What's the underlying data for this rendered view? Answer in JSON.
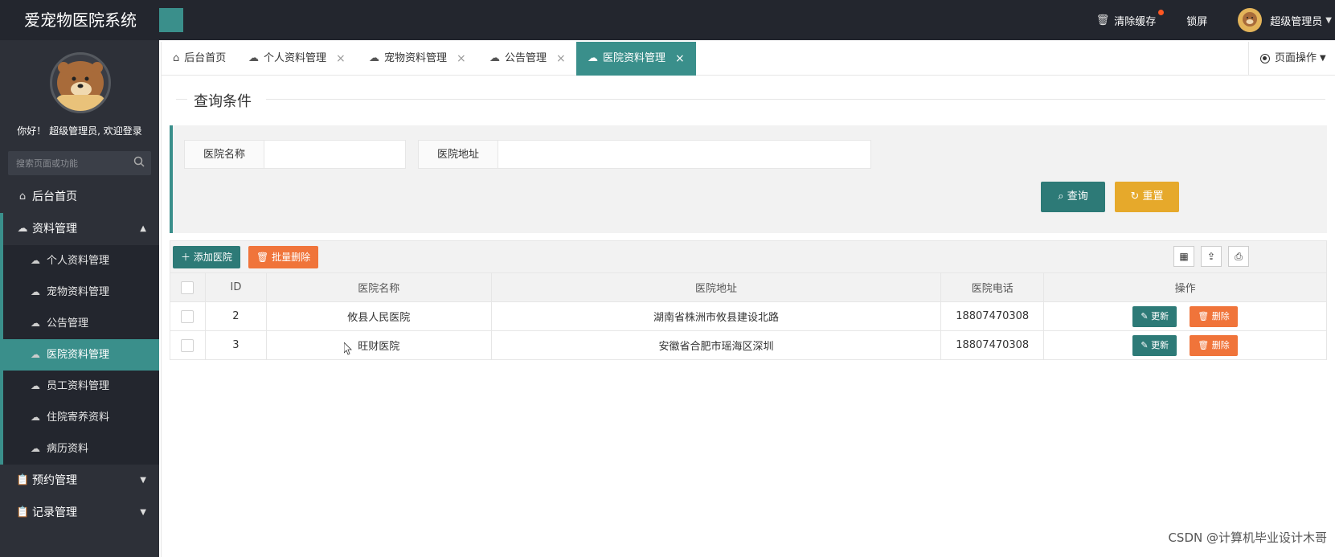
{
  "topbar": {
    "brand": "爱宠物医院系统",
    "clear_cache": "清除缓存",
    "lock": "锁屏",
    "user": "超级管理员"
  },
  "sidebar": {
    "welcome": "你好！ 超级管理员, 欢迎登录",
    "search_placeholder": "搜索页面或功能",
    "items": [
      {
        "label": "后台首页",
        "icon": "home-icon"
      },
      {
        "label": "资料管理",
        "icon": "cloud-icon"
      },
      {
        "label": "预约管理",
        "icon": "clipboard-icon"
      },
      {
        "label": "记录管理",
        "icon": "clipboard-icon"
      }
    ],
    "sub_items": [
      {
        "label": "个人资料管理"
      },
      {
        "label": "宠物资料管理"
      },
      {
        "label": "公告管理"
      },
      {
        "label": "医院资料管理"
      },
      {
        "label": "员工资料管理"
      },
      {
        "label": "住院寄养资料"
      },
      {
        "label": "病历资料"
      }
    ]
  },
  "tabs": [
    {
      "label": "后台首页"
    },
    {
      "label": "个人资料管理"
    },
    {
      "label": "宠物资料管理"
    },
    {
      "label": "公告管理"
    },
    {
      "label": "医院资料管理"
    }
  ],
  "page_ops": "页面操作",
  "query": {
    "legend": "查询条件",
    "name_label": "医院名称",
    "name_value": "",
    "addr_label": "医院地址",
    "addr_value": "",
    "search_btn": "查询",
    "reset_btn": "重置"
  },
  "toolbar": {
    "add_btn": "添加医院",
    "batch_del_btn": "批量删除"
  },
  "table": {
    "headers": [
      "ID",
      "医院名称",
      "医院地址",
      "医院电话",
      "操作"
    ],
    "rows": [
      {
        "id": "2",
        "name": "攸县人民医院",
        "address": "湖南省株洲市攸县建设北路",
        "phone": "18807470308"
      },
      {
        "id": "3",
        "name": "旺财医院",
        "address": "安徽省合肥市瑶海区深圳",
        "phone": "18807470308"
      }
    ],
    "update_btn": "更新",
    "delete_btn": "删除"
  },
  "watermark": "CSDN @计算机毕业设计木哥",
  "colors": {
    "accent": "#3a8f8b",
    "warning": "#e6a92b",
    "danger": "#f0743a",
    "topbar": "#23262e"
  }
}
